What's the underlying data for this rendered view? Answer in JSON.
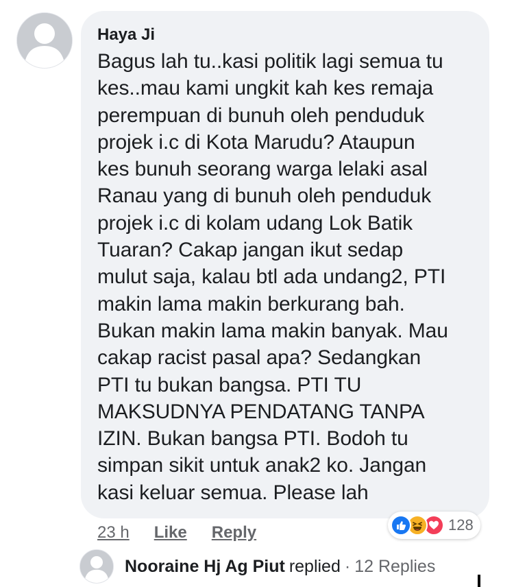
{
  "comment": {
    "author": "Haya Ji",
    "text": "Bagus lah tu..kasi politik lagi semua tu\nkes..mau kami ungkit kah kes remaja\nperempuan di bunuh oleh penduduk\nprojek i.c di Kota Marudu? Ataupun\nkes bunuh seorang warga lelaki asal\nRanau yang di bunuh oleh penduduk\nprojek i.c di kolam udang Lok Batik\nTuaran? Cakap jangan ikut sedap\nmulut saja, kalau btl ada undang2, PTI\nmakin lama makin berkurang bah.\nBukan makin lama makin banyak. Mau\ncakap racist pasal apa? Sedangkan\nPTI tu bukan bangsa. PTI TU\nMAKSUDNYA PENDATANG TANPA\nIZIN. Bukan bangsa PTI. Bodoh tu\nsimpan sikit untuk anak2 ko. Jangan\nkasi keluar semua. Please lah",
    "avatar_icon": "default-user-avatar-icon"
  },
  "actions": {
    "time": "23 h",
    "like_label": "Like",
    "reply_label": "Reply"
  },
  "reactions": {
    "icons": [
      "like-reaction-icon",
      "haha-reaction-icon",
      "love-reaction-icon"
    ],
    "count": "128",
    "colors": {
      "like": "#1877f2",
      "haha": "#f7b125",
      "love": "#f33e58"
    }
  },
  "reply": {
    "name": "Nooraine Hj Ag Piut",
    "text": "replied",
    "separator": "·",
    "count_text": "12 Replies",
    "avatar_icon": "default-user-avatar-icon"
  },
  "colors": {
    "bubble": "#f0f2f5",
    "text": "#1c1e21",
    "secondary": "#65676b"
  }
}
